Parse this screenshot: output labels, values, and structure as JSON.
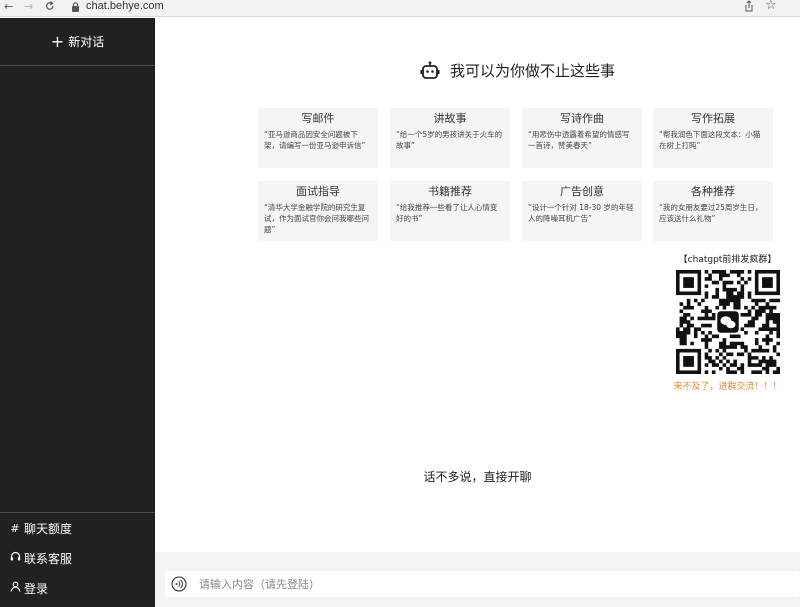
{
  "browser": {
    "back": "←",
    "forward": "→",
    "reload": "C",
    "url": "chat.behye.com",
    "star": "☆"
  },
  "sidebar": {
    "new_chat": "新对话",
    "items": [
      {
        "label": "聊天额度",
        "icon": "hash-icon"
      },
      {
        "label": "联系客服",
        "icon": "headset-icon"
      },
      {
        "label": "登录",
        "icon": "user-icon"
      }
    ]
  },
  "main": {
    "header_title": "我可以为你做不止这些事",
    "cards": [
      {
        "title": "写邮件",
        "desc": "“亚马逊商品因安全问题被下架，请编写一份亚马逊申诉信”"
      },
      {
        "title": "讲故事",
        "desc": "“给一个5岁的男孩讲关于火车的故事”"
      },
      {
        "title": "写诗作曲",
        "desc": "“用悲伤中透露着希望的情感写一首诗，赞美春天”"
      },
      {
        "title": "写作拓展",
        "desc": "“帮我润色下面这段文本：小猫在树上打盹”"
      },
      {
        "title": "面试指导",
        "desc": "“清华大学金融学院的研究生复试，作为面试官你会问我哪些问题”"
      },
      {
        "title": "书籍推荐",
        "desc": "“给我推荐一些看了让人心情变好的书”"
      },
      {
        "title": "广告创意",
        "desc": "“设计一个针对 18-30 岁的年轻人的降噪耳机广告”"
      },
      {
        "title": "各种推荐",
        "desc": "“我的女朋友要过25周岁生日，应该送什么礼物”"
      }
    ],
    "qr_title": "【chatgpt前排发疯群】",
    "qr_note": "来不及了，进群交流！！！",
    "center_text": "话不多说，直接开聊",
    "input_placeholder": "请输入内容（请先登陆）"
  },
  "colors": {
    "sidebar_bg": "#202123",
    "card_bg": "#f5f5f5",
    "qr_note": "#e08c2c"
  }
}
